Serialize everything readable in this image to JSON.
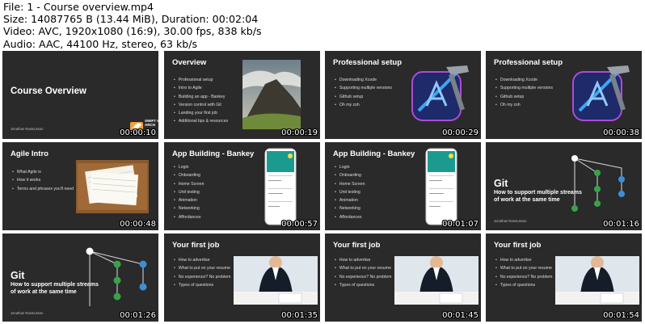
{
  "info": {
    "file": "File: 1 - Course overview.mp4",
    "size": "Size: 14087765 B (13.44 MiB), Duration: 00:02:04",
    "video": "Video: AVC, 1920x1080 (16:9), 30.00 fps, 838 kb/s",
    "audio": "Audio: AAC, 44100 Hz, stereo, 63 kb/s"
  },
  "thumbs": [
    {
      "title": "Course Overview",
      "author": "Jonathan Rasmusson",
      "logo": "SWIFT IN ARCH",
      "time": "00:00:10"
    },
    {
      "title": "Overview",
      "bullets": [
        "Professional setup",
        "Intro to Agile",
        "Building an app - Bankey",
        "Version control with Git",
        "Landing your first job",
        "Additional tips & resources"
      ],
      "time": "00:00:19"
    },
    {
      "title": "Professional setup",
      "bullets": [
        "Downloading Xcode",
        "Supporting multiple versions",
        "Github setup",
        "Oh my zsh"
      ],
      "time": "00:00:29"
    },
    {
      "title": "Professional setup",
      "bullets": [
        "Downloading Xcode",
        "Supporting multiple versions",
        "Github setup",
        "Oh my zsh"
      ],
      "time": "00:00:38"
    },
    {
      "title": "Agile Intro",
      "bullets": [
        "What Agile is",
        "How it works",
        "Terms and phrases you'll need"
      ],
      "time": "00:00:48"
    },
    {
      "title": "App Building - Bankey",
      "bullets": [
        "Login",
        "Onboarding",
        "Home Screen",
        "Unit testing",
        "Animation",
        "Networking",
        "Affordances"
      ],
      "time": "00:00:57"
    },
    {
      "title": "App Building - Bankey",
      "bullets": [
        "Login",
        "Onboarding",
        "Home Screen",
        "Unit testing",
        "Animation",
        "Networking",
        "Affordances"
      ],
      "time": "00:01:07"
    },
    {
      "title": "Git",
      "subtitle": "How to support multiple streams of work at the same time",
      "author": "Jonathan Rasmusson",
      "time": "00:01:16"
    },
    {
      "title": "Git",
      "subtitle": "How to support multiple streams of work at the same time",
      "author": "Jonathan Rasmusson",
      "time": "00:01:26"
    },
    {
      "title": "Your first job",
      "bullets": [
        "How to advertise",
        "What to put on your resume",
        "No experience? No problem",
        "Types of questions"
      ],
      "time": "00:01:35"
    },
    {
      "title": "Your first job",
      "bullets": [
        "How to advertise",
        "What to put on your resume",
        "No experience? No problem",
        "Types of questions"
      ],
      "time": "00:01:45"
    },
    {
      "title": "Your first job",
      "bullets": [
        "How to advertise",
        "What to put on your resume",
        "No experience? No problem",
        "Types of questions"
      ],
      "time": "00:01:54"
    }
  ]
}
